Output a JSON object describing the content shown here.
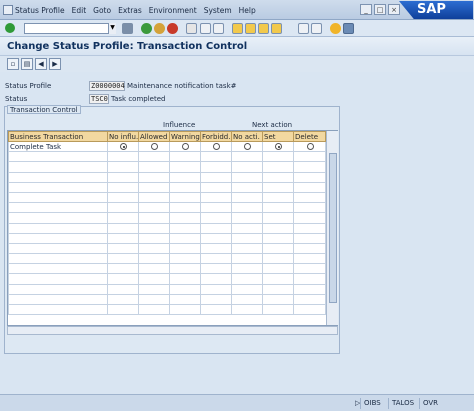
{
  "menu": [
    "Status Profile",
    "Edit",
    "Goto",
    "Extras",
    "Environment",
    "System",
    "Help"
  ],
  "window_buttons": [
    "_",
    "□",
    "×"
  ],
  "logo_text": "SAP",
  "title": "Change Status Profile: Transaction Control",
  "fields": {
    "status_profile": {
      "label": "Status Profile",
      "value": "Z0000004",
      "description": "Maintenance notification task#"
    },
    "status": {
      "label": "Status",
      "value": "TSC0",
      "description": "Task completed"
    }
  },
  "group_title": "Transaction Control",
  "header_groups": {
    "influence": "Influence",
    "next_action": "Next action"
  },
  "table": {
    "columns": [
      "Business Transaction",
      "No influ.",
      "Allowed",
      "Warning",
      "Forbidd.",
      "No acti.",
      "Set",
      "Delete"
    ],
    "rows": [
      {
        "name": "Complete Task",
        "influence": "No influ.",
        "next_action": "Set"
      }
    ]
  },
  "statusbar": [
    "OIBS",
    "TALOS",
    "OVR"
  ],
  "colors": {
    "header_bg": "#f2d8a0",
    "accent": "#10315e"
  }
}
